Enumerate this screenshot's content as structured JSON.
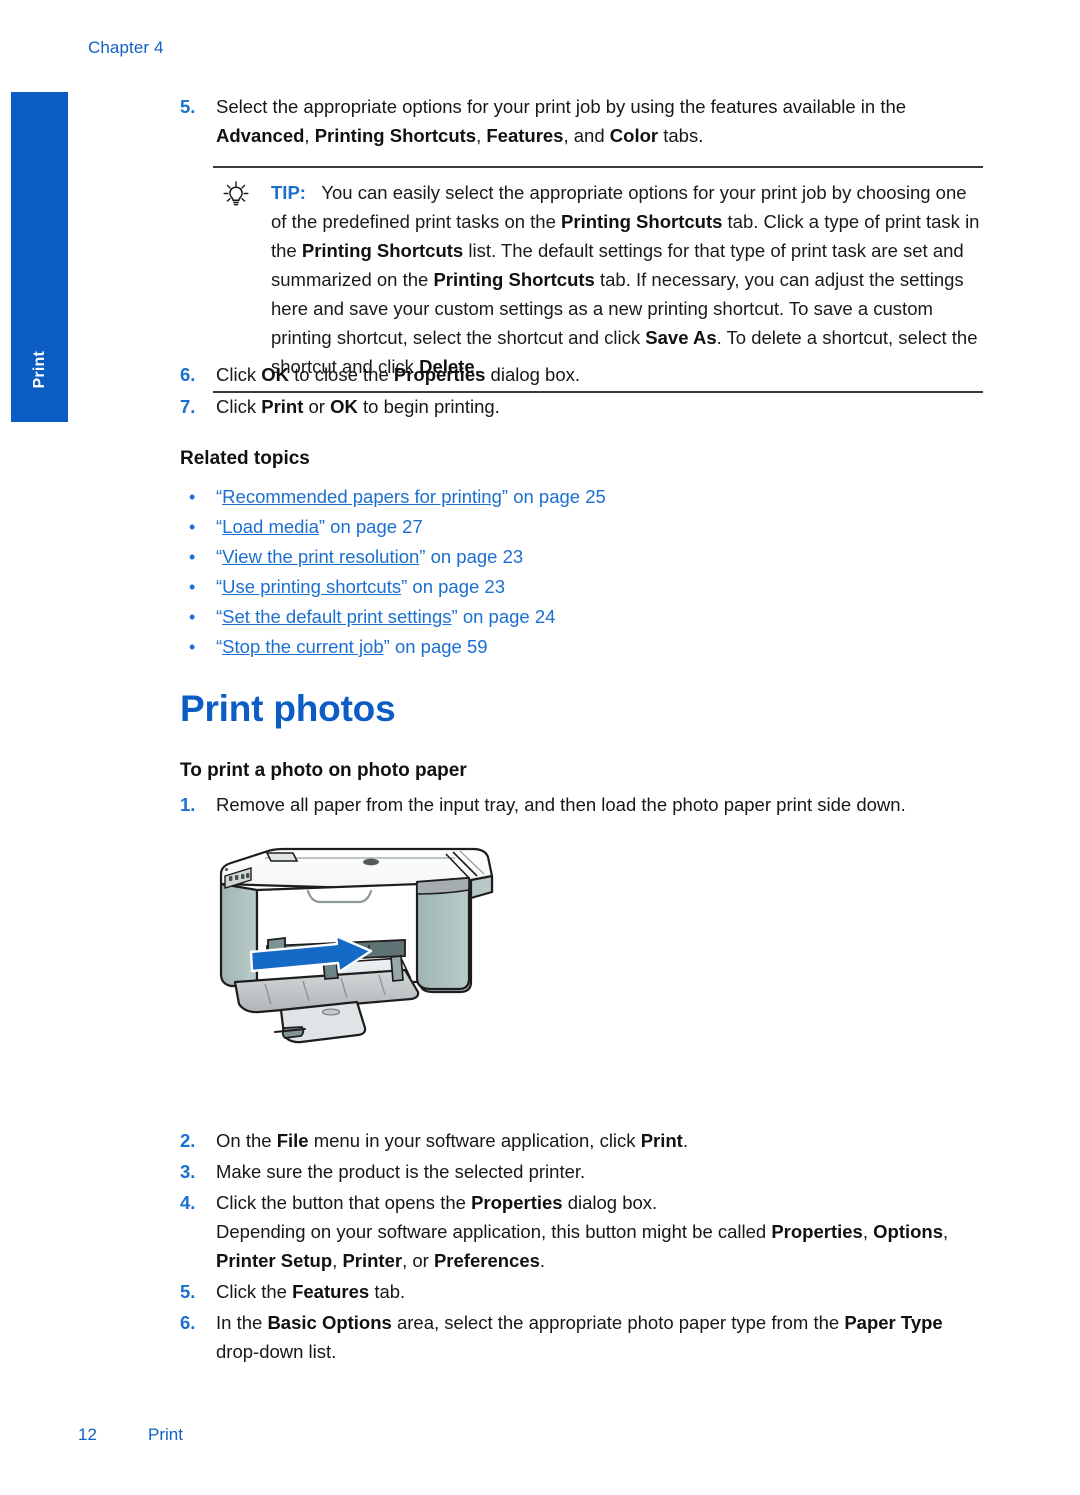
{
  "page": {
    "chapter_header": "Chapter 4",
    "side_tab_label": "Print",
    "footer_page_number": "12",
    "footer_section": "Print",
    "accent_blue": "#0b5cc4",
    "link_blue": "#1b6fd0",
    "text_black": "#171717"
  },
  "steps_top": [
    {
      "num": "5.",
      "html": "Select the appropriate options for your print job by using the features available in the <b>Advanced</b>, <b>Printing Shortcuts</b>, <b>Features</b>, and <b>Color</b> tabs."
    }
  ],
  "tip": {
    "icon": "lightbulb-icon",
    "keyword": "TIP:",
    "html": "You can easily select the appropriate options for your print job by choosing one of the predefined print tasks on the <b>Printing Shortcuts</b> tab. Click a type of print task in the <b>Printing Shortcuts</b> list. The default settings for that type of print task are set and summarized on the <b>Printing Shortcuts</b> tab. If necessary, you can adjust the settings here and save your custom settings as a new printing shortcut. To save a custom printing shortcut, select the shortcut and click <b>Save As</b>. To delete a shortcut, select the shortcut and click <b>Delete</b>."
  },
  "steps_after_tip": [
    {
      "num": "6.",
      "html": "Click <b>OK</b> to close the <b>Properties</b> dialog box."
    },
    {
      "num": "7.",
      "html": "Click <b>Print</b> or <b>OK</b> to begin printing."
    }
  ],
  "related_topics": {
    "heading": "Related topics",
    "items": [
      {
        "bullet": "•",
        "quote_open": "“",
        "link": "Recommended papers for printing",
        "quote_close": "”",
        "tail": " on page 25"
      },
      {
        "bullet": "•",
        "quote_open": "“",
        "link": "Load media",
        "quote_close": "”",
        "tail": " on page 27"
      },
      {
        "bullet": "•",
        "quote_open": "“",
        "link": "View the print resolution",
        "quote_close": "”",
        "tail": " on page 23"
      },
      {
        "bullet": "•",
        "quote_open": "“",
        "link": "Use printing shortcuts",
        "quote_close": "”",
        "tail": " on page 23"
      },
      {
        "bullet": "•",
        "quote_open": "“",
        "link": "Set the default print settings",
        "quote_close": "”",
        "tail": " on page 24"
      },
      {
        "bullet": "•",
        "quote_open": "“",
        "link": "Stop the current job",
        "quote_close": "”",
        "tail": " on page 59"
      }
    ]
  },
  "section": {
    "title": "Print photos",
    "subtitle": "To print a photo on photo paper",
    "step1": {
      "num": "1.",
      "html": "Remove all paper from the input tray, and then load the photo paper print side down."
    },
    "figure_alt": "hp-all-in-one-printer-load-photo-paper-illustration",
    "steps_rest": [
      {
        "num": "2.",
        "html": "On the <b>File</b> menu in your software application, click <b>Print</b>."
      },
      {
        "num": "3.",
        "html": "Make sure the product is the selected printer."
      },
      {
        "num": "4.",
        "html": "Click the button that opens the <b>Properties</b> dialog box.<br>Depending on your software application, this button might be called <b>Properties</b>, <b>Options</b>, <b>Printer Setup</b>, <b>Printer</b>, or <b>Preferences</b>."
      },
      {
        "num": "5.",
        "html": "Click the <b>Features</b> tab."
      },
      {
        "num": "6.",
        "html": "In the <b>Basic Options</b> area, select the appropriate photo paper type from the <b>Paper Type</b> drop-down list."
      }
    ]
  }
}
